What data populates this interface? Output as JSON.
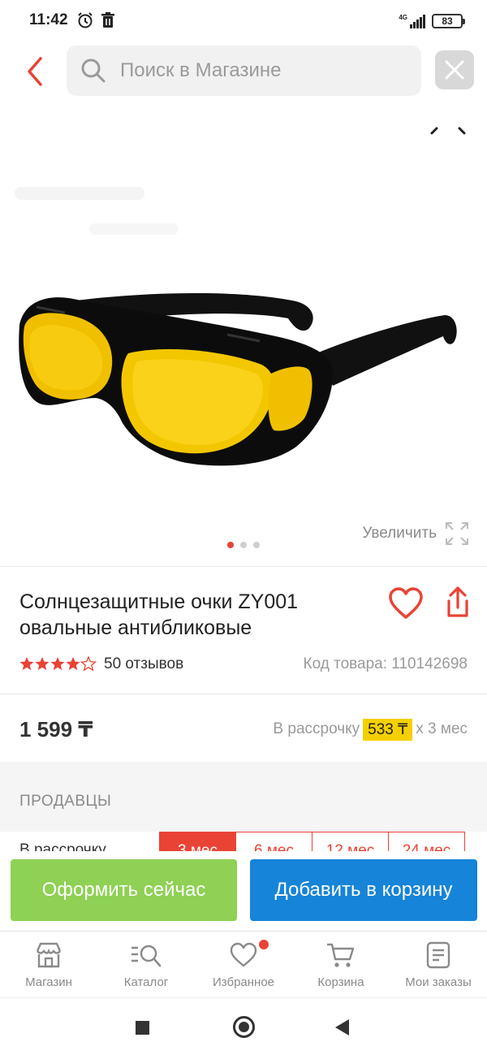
{
  "status_bar": {
    "time": "11:42",
    "network": "4G",
    "battery": "83",
    "icons": [
      "alarm-icon",
      "trash-icon",
      "signal-icon",
      "battery-icon"
    ]
  },
  "header": {
    "search_placeholder": "Поиск в Магазине",
    "back_icon": "chevron-left-icon",
    "close_icon": "close-icon"
  },
  "gallery": {
    "zoom_label": "Увеличить",
    "image_description_icon": "yellow-night-vision-glasses",
    "dots_total": 3,
    "dots_active": 1
  },
  "product": {
    "title": "Солнцезащитные очки ZY001 овальные антибликовые",
    "rating": 4.5,
    "reviews_label": "50 отзывов",
    "sku_label": "Код товара: 110142698",
    "price": "1 599 ₸",
    "installment_prefix": "В рассрочку",
    "installment_amount": "533 ₸",
    "installment_suffix": "x 3 мес"
  },
  "sellers": {
    "section_label": "ПРОДАВЦЫ",
    "installment_label": "В рассрочку",
    "options": [
      "3 мес",
      "6 мес",
      "12 мес",
      "24 мес"
    ],
    "active_option": "3 мес"
  },
  "actions": {
    "buy_now": "Оформить сейчас",
    "add_to_cart": "Добавить в корзину"
  },
  "bottom_nav": {
    "items": [
      {
        "label": "Магазин",
        "icon": "store-icon"
      },
      {
        "label": "Каталог",
        "icon": "catalog-search-icon"
      },
      {
        "label": "Избранное",
        "icon": "heart-icon"
      },
      {
        "label": "Корзина",
        "icon": "cart-icon"
      },
      {
        "label": "Мои заказы",
        "icon": "orders-icon"
      }
    ]
  },
  "colors": {
    "accent_red": "#e94336",
    "buy_now_green": "#8ed154",
    "cart_blue": "#1684d8",
    "highlight_yellow": "#f5d000"
  }
}
